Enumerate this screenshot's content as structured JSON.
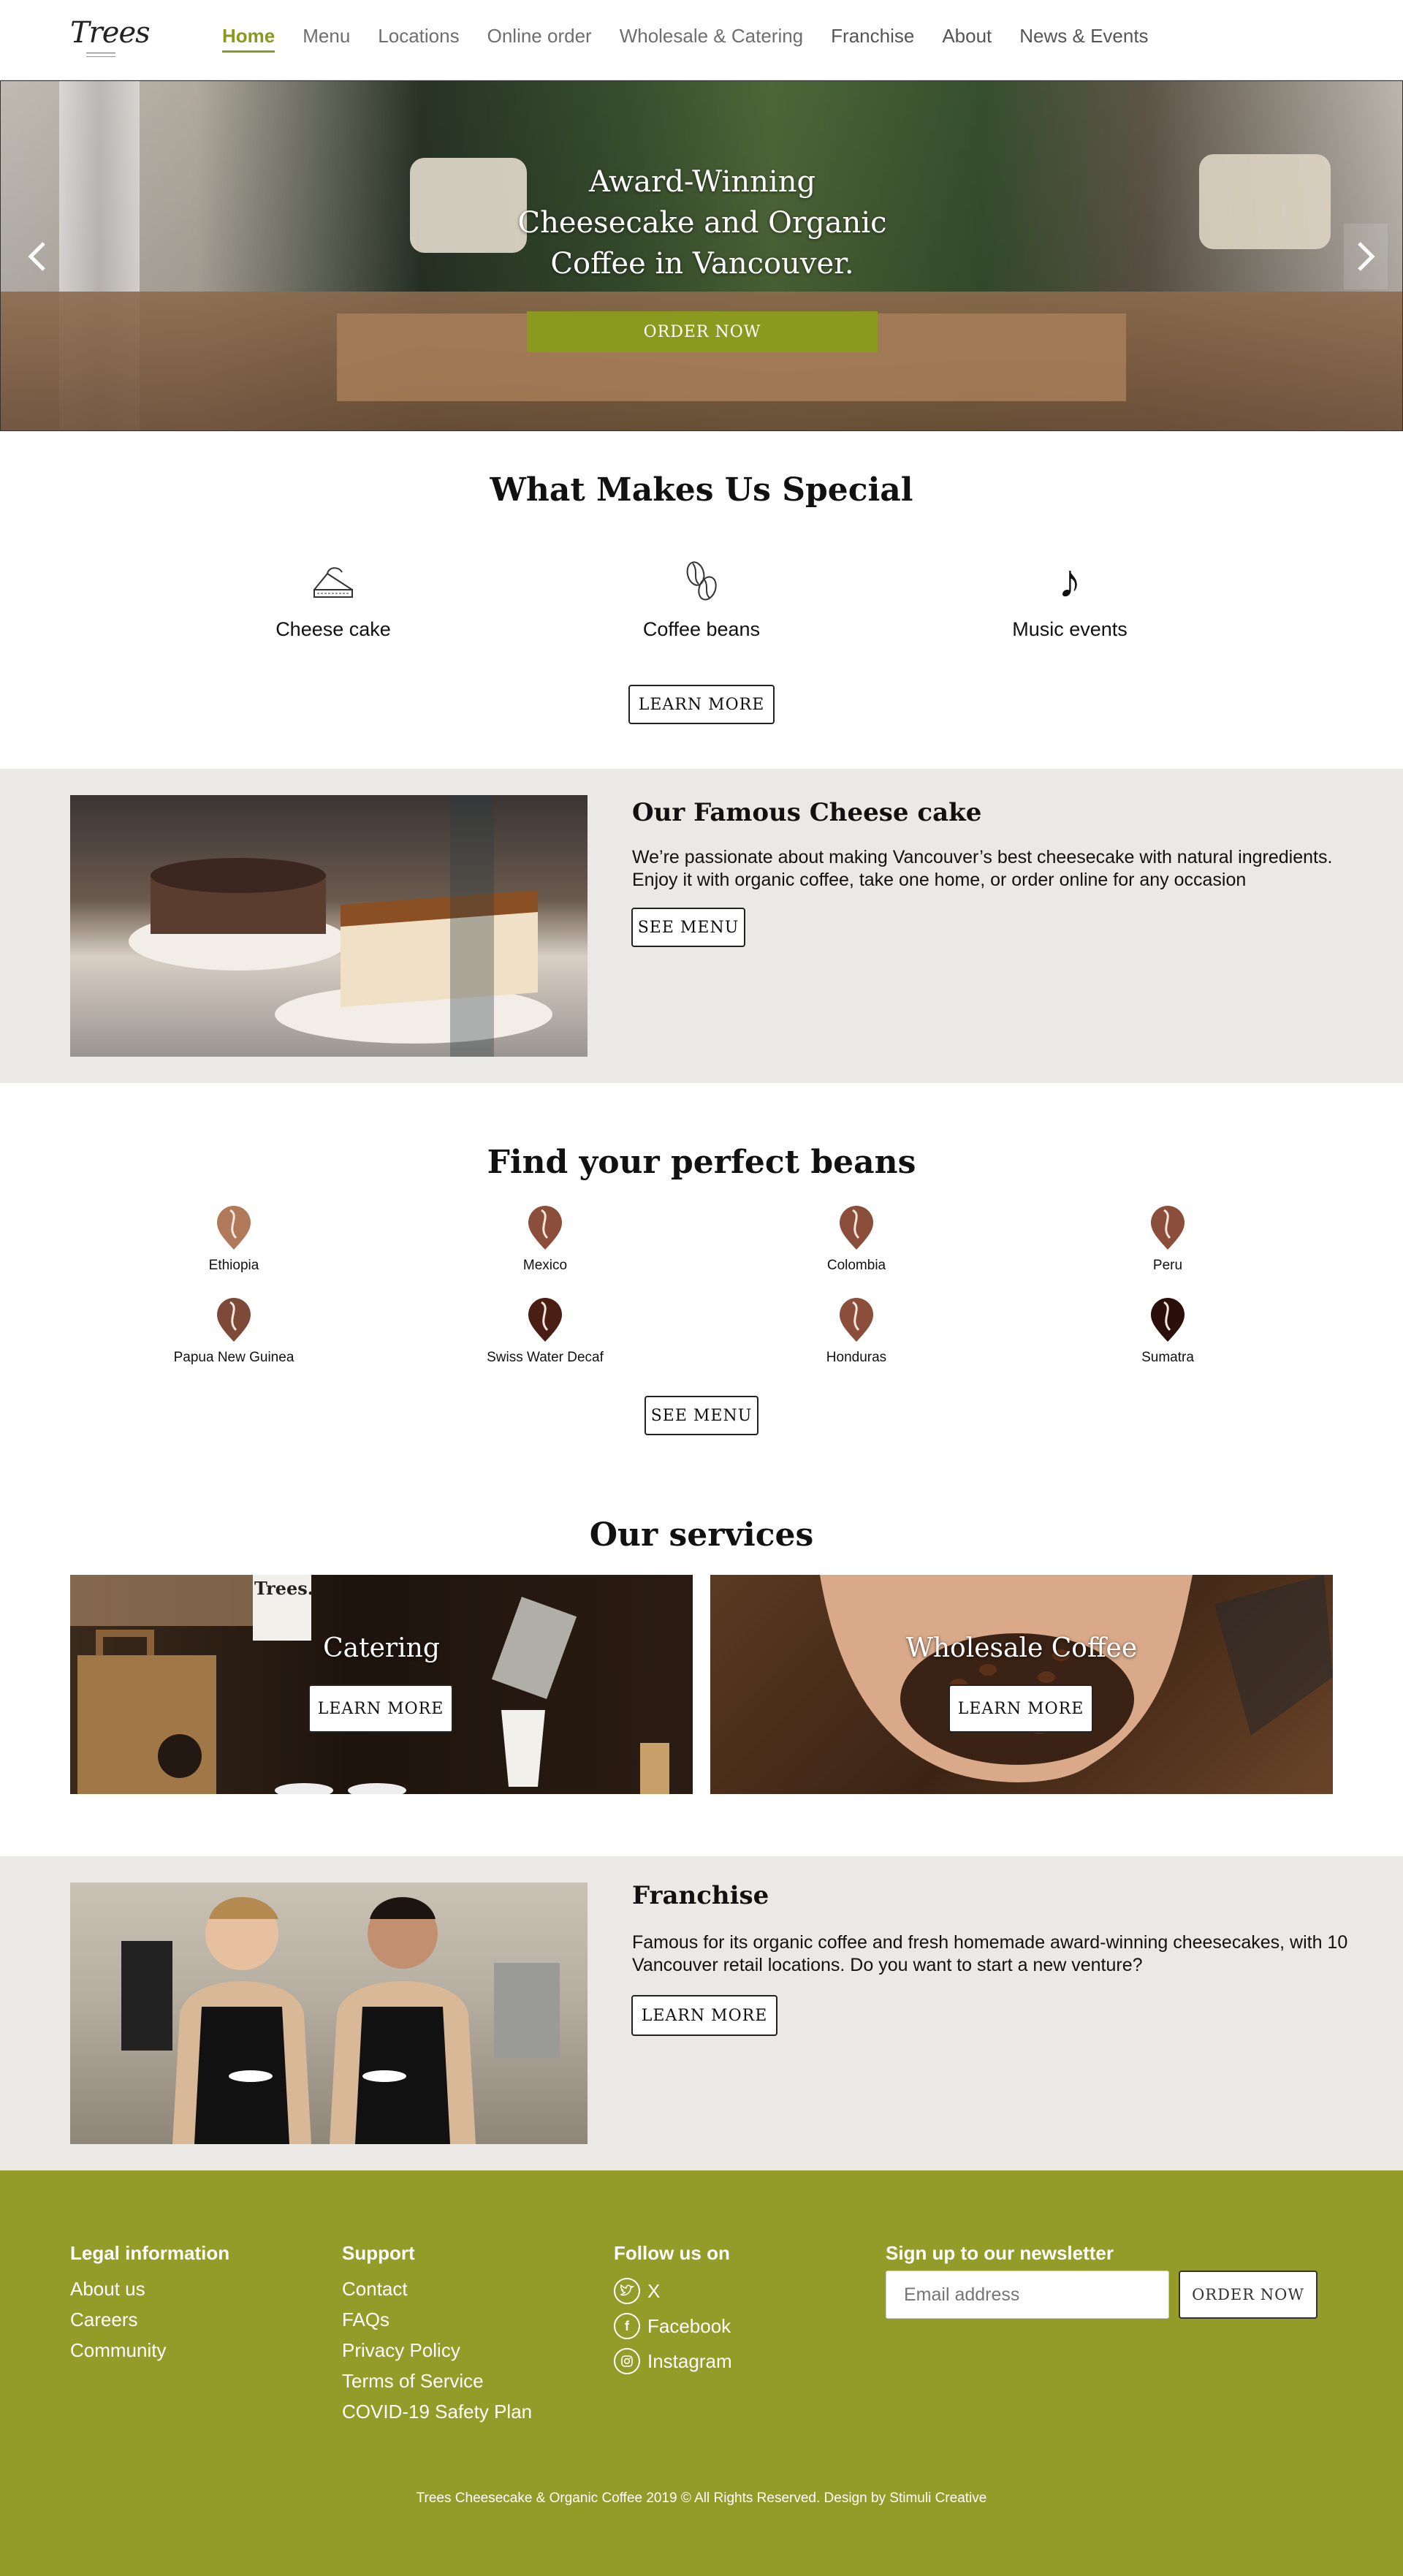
{
  "header": {
    "logo_text": "Trees",
    "nav": [
      "Home",
      "Menu",
      "Locations",
      "Online order",
      "Wholesale & Catering",
      "Franchise",
      "About",
      "News & Events"
    ]
  },
  "hero": {
    "title_line1": "Award-Winning",
    "title_line2": "Cheesecake and Organic",
    "title_line3": "Coffee in Vancouver.",
    "cta": "ORDER NOW",
    "prev_icon": "chevron-left-icon",
    "next_icon": "chevron-right-icon"
  },
  "special": {
    "title": "What Makes Us Special",
    "features": [
      {
        "label": "Cheese cake",
        "icon": "cheesecake-icon"
      },
      {
        "label": "Coffee beans",
        "icon": "coffee-beans-icon"
      },
      {
        "label": "Music events",
        "icon": "music-note-icon"
      }
    ],
    "cta": "LEARN MORE"
  },
  "cheesecake": {
    "title": "Our Famous Cheese cake",
    "text_line1": "We’re passionate about making Vancouver’s best cheesecake with natural ingredients.",
    "text_line2": "Enjoy it with organic coffee, take one home, or order online for any occasion",
    "cta": "SEE MENU"
  },
  "beans": {
    "title": "Find your perfect beans",
    "items": [
      {
        "name": "Ethiopia",
        "color": "#b07a5a"
      },
      {
        "name": "Mexico",
        "color": "#8a4e3a"
      },
      {
        "name": "Colombia",
        "color": "#8a4e3a"
      },
      {
        "name": "Peru",
        "color": "#8a4e3a"
      },
      {
        "name": "Papua New Guinea",
        "color": "#7d4a3a"
      },
      {
        "name": "Swiss Water Decaf",
        "color": "#4a1e12"
      },
      {
        "name": "Honduras",
        "color": "#8a4e3a"
      },
      {
        "name": "Sumatra",
        "color": "#2b0f0a"
      }
    ],
    "cta": "SEE MENU"
  },
  "services": {
    "title": "Our services",
    "cards": [
      {
        "title": "Catering",
        "cta": "LEARN MORE",
        "cup_text": "Trees."
      },
      {
        "title": "Wholesale Coffee",
        "cta": "LEARN MORE"
      }
    ]
  },
  "franchise": {
    "title": "Franchise",
    "text_line1": "Famous for its organic coffee and fresh homemade award-winning cheesecakes, with 10",
    "text_line2": "Vancouver retail locations. Do you want to start a new venture?",
    "cta": "LEARN MORE"
  },
  "footer": {
    "legal": {
      "heading": "Legal information",
      "links": [
        "About us",
        "Careers",
        "Community"
      ]
    },
    "support": {
      "heading": "Support",
      "links": [
        "Contact",
        "FAQs",
        "Privacy Policy",
        "Terms of Service",
        "COVID-19 Safety Plan"
      ]
    },
    "follow": {
      "heading": "Follow us on",
      "links": [
        {
          "label": "X",
          "icon": "twitter-bird-icon"
        },
        {
          "label": "Facebook",
          "icon": "facebook-icon"
        },
        {
          "label": "Instagram",
          "icon": "instagram-icon"
        }
      ]
    },
    "newsletter": {
      "heading": "Sign up to our newsletter",
      "placeholder": "Email address",
      "cta": "ORDER NOW"
    },
    "copyright": "Trees Cheesecake & Organic Coffee 2019 © All Rights Reserved. Design by Stimuli Creative"
  },
  "colors": {
    "accent": "#8a9a1e",
    "footer_bg": "#939b29",
    "band_bg": "#ebe9e6"
  }
}
